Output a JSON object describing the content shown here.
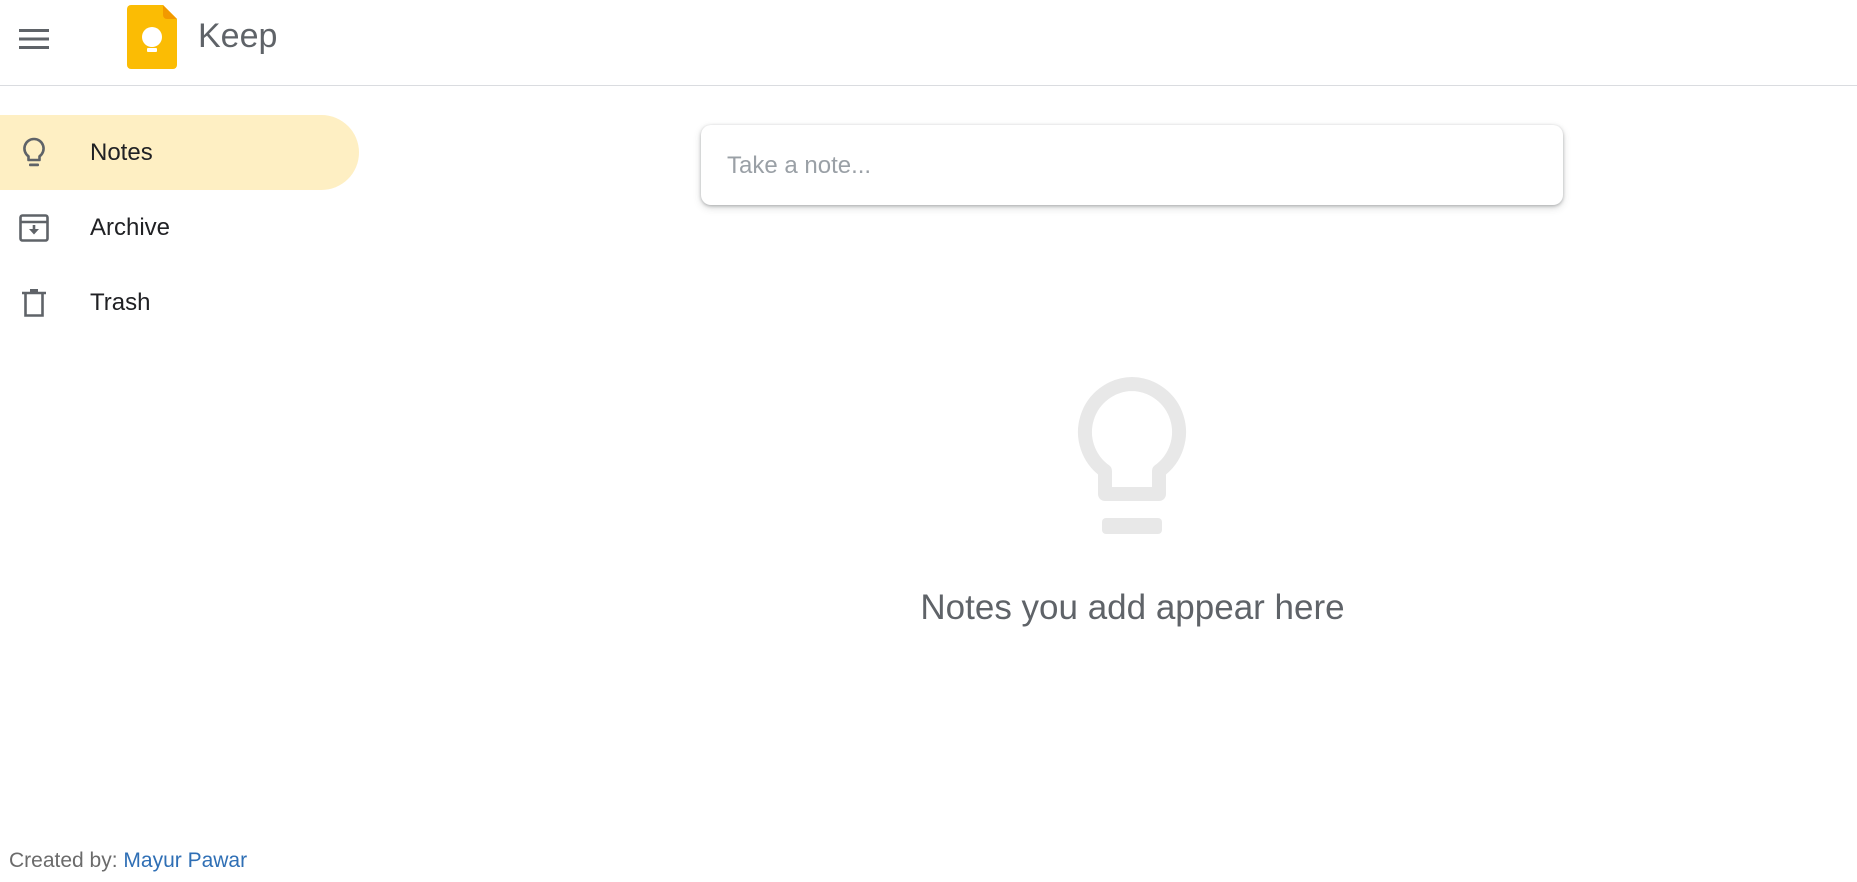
{
  "header": {
    "menu_icon": "hamburger-menu-icon",
    "logo_icon": "keep-logo-icon",
    "title": "Keep"
  },
  "sidebar": {
    "items": [
      {
        "label": "Notes",
        "icon": "lightbulb-icon",
        "active": true
      },
      {
        "label": "Archive",
        "icon": "archive-icon",
        "active": false
      },
      {
        "label": "Trash",
        "icon": "trash-icon",
        "active": false
      }
    ]
  },
  "main": {
    "note_input": {
      "placeholder": "Take a note...",
      "value": ""
    },
    "empty_state": {
      "icon": "lightbulb-icon",
      "text": "Notes you add appear here"
    }
  },
  "footer": {
    "prefix": "Created by:",
    "author": "Mayur Pawar"
  },
  "colors": {
    "active_nav": "#feefc3",
    "logo_yellow": "#fbbc04",
    "link": "#2f6fb5"
  }
}
